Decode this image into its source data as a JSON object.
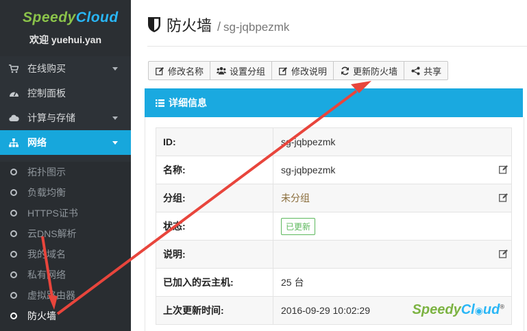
{
  "sidebar": {
    "logo": {
      "part1": "Speedy",
      "part2": "Cloud"
    },
    "welcome": "欢迎 yuehui.yan",
    "items": [
      {
        "label": "在线购买",
        "icon": "cart-icon",
        "has_caret": true
      },
      {
        "label": "控制面板",
        "icon": "dashboard-icon",
        "has_caret": false
      },
      {
        "label": "计算与存储",
        "icon": "cloud-icon",
        "has_caret": true
      },
      {
        "label": "网络",
        "icon": "sitemap-icon",
        "has_caret": true,
        "active": true
      }
    ],
    "subitems": [
      {
        "label": "拓扑图示"
      },
      {
        "label": "负载均衡"
      },
      {
        "label": "HTTPS证书"
      },
      {
        "label": "云DNS解析"
      },
      {
        "label": "我的域名"
      },
      {
        "label": "私有网络"
      },
      {
        "label": "虚拟路由器"
      },
      {
        "label": "防火墙",
        "current": true
      }
    ]
  },
  "header": {
    "title": "防火墙",
    "separator": "/",
    "subtitle": "sg-jqbpezmk"
  },
  "toolbar": {
    "buttons": [
      {
        "label": "修改名称",
        "icon": "edit-icon"
      },
      {
        "label": "设置分组",
        "icon": "users-icon"
      },
      {
        "label": "修改说明",
        "icon": "edit-icon"
      },
      {
        "label": "更新防火墙",
        "icon": "refresh-icon"
      },
      {
        "label": "共享",
        "icon": "share-icon"
      }
    ]
  },
  "panel": {
    "title": "详细信息",
    "rows": [
      {
        "key": "ID:",
        "value": "sg-jqbpezmk"
      },
      {
        "key": "名称:",
        "value": "sg-jqbpezmk",
        "editable": true
      },
      {
        "key": "分组:",
        "value": "未分组",
        "editable": true
      },
      {
        "key": "状态:",
        "value": "已更新",
        "badge": true
      },
      {
        "key": "说明:",
        "value": "",
        "editable": true
      },
      {
        "key": "已加入的云主机:",
        "value": "25 台"
      },
      {
        "key": "上次更新时间:",
        "value": "2016-09-29 10:02:29"
      }
    ]
  },
  "watermark": {
    "part1": "Speedy",
    "part2": "Cl",
    "part3": "ud",
    "reg": "®"
  },
  "colors": {
    "accent": "#17a7dc",
    "sidebar": "#2d3237",
    "arrow": "#e8453c",
    "badge": "#5cb85c"
  }
}
